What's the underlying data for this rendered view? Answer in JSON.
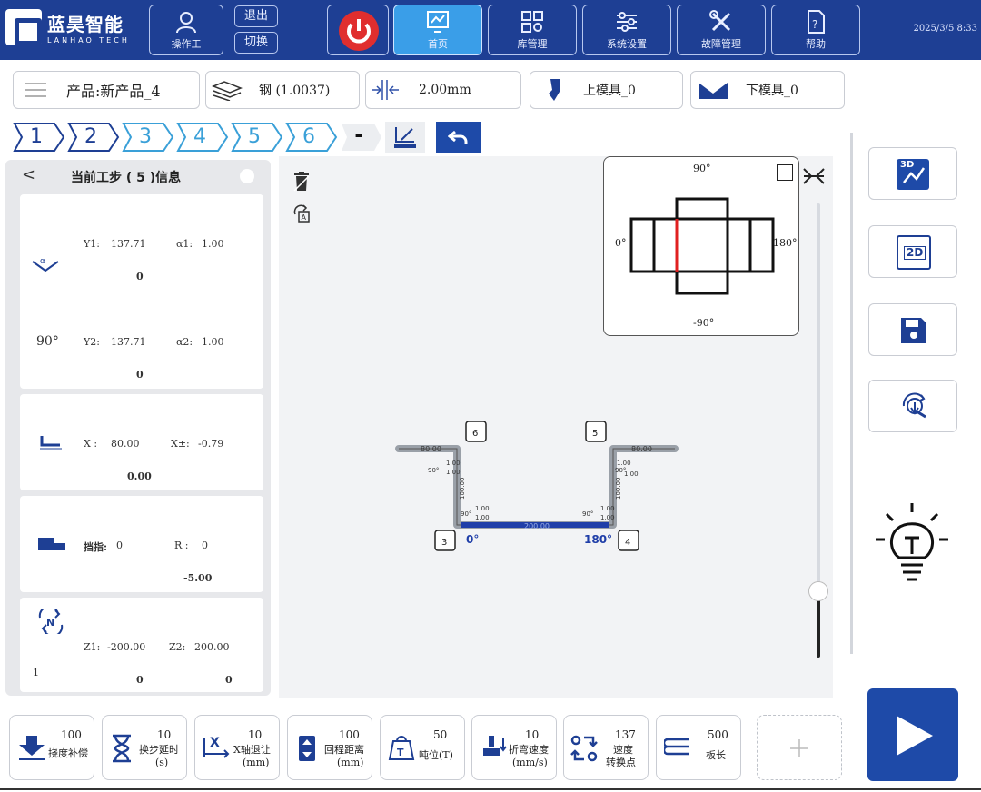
{
  "app": {
    "brand_cn": "蓝昊智能",
    "brand_en": "LANHAO TECH",
    "datetime": "2025/3/5 8:33"
  },
  "topnav": {
    "operator": "操作工",
    "logout": "退出",
    "switch": "切换",
    "home": "首页",
    "library": "库管理",
    "settings": "系统设置",
    "fault": "故障管理",
    "help": "帮助"
  },
  "product_bar": {
    "product": "产品:新产品_4",
    "material": "钢 (1.0037)",
    "thickness": "2.00mm",
    "upper_die": "上模具_0",
    "lower_die": "下模具_0"
  },
  "steps": [
    "1",
    "2",
    "3",
    "4",
    "5",
    "6"
  ],
  "step_minus": "-",
  "panel": {
    "back": "<",
    "title": "当前工步 ( 5 )信息",
    "angle_card": {
      "y1_label": "Y1:",
      "y1": "137.71",
      "a1_label": "α1:",
      "a1": "1.00",
      "v1": "0",
      "angle": "90°",
      "y2_label": "Y2:",
      "y2": "137.71",
      "a2_label": "α2:",
      "a2": "1.00",
      "v2": "0"
    },
    "x_card": {
      "x_label": "X :",
      "x": "80.00",
      "xpm_label": "X±:",
      "xpm": "-0.79",
      "v": "0.00"
    },
    "finger_card": {
      "finger_label": "挡指:",
      "finger": "0",
      "r_label": "R :",
      "r": "0",
      "v": "-5.00"
    },
    "z_card": {
      "n_icon": "N",
      "z1_label": "Z1:",
      "z1": "-200.00",
      "z2_label": "Z2:",
      "z2": "200.00",
      "count": "1",
      "v1": "0",
      "v2": "0"
    }
  },
  "preview": {
    "top": "90°",
    "left": "0°",
    "right": "180°",
    "bottom": "-90°"
  },
  "drawing": {
    "dim_top_left": "80.00",
    "dim_top_right": "80.00",
    "dim_bottom": "200.00",
    "dim_left_vert": "100.00",
    "dim_right_vert": "100.00",
    "small_a": "1.00",
    "small_b": "1.00",
    "angle_small": "90°",
    "left_angle": "0°",
    "right_angle": "180°",
    "tag3": "3",
    "tag4": "4",
    "tag5": "5",
    "tag6": "6"
  },
  "right_tools": {
    "btn_3d": "3D",
    "btn_2d": "2D"
  },
  "bottom": [
    {
      "num": "100",
      "label": "挠度补偿"
    },
    {
      "num": "10",
      "label": "换步延时",
      "unit": "(s)"
    },
    {
      "num": "10",
      "label": "X轴退让",
      "unit": "(mm)"
    },
    {
      "num": "100",
      "label": "回程距离",
      "unit": "(mm)"
    },
    {
      "num": "50",
      "label": "吨位(T)"
    },
    {
      "num": "10",
      "label": "折弯速度",
      "unit": "(mm/s)"
    },
    {
      "num": "137",
      "label": "速度",
      "label2": "转换点"
    },
    {
      "num": "500",
      "label": "板长"
    }
  ],
  "colors": {
    "nav": "#1e3f94",
    "accent": "#3a9ee8",
    "step_blue": "#3aa0d8",
    "profile_blue": "#1f3ea8",
    "power": "#e02e2e"
  }
}
